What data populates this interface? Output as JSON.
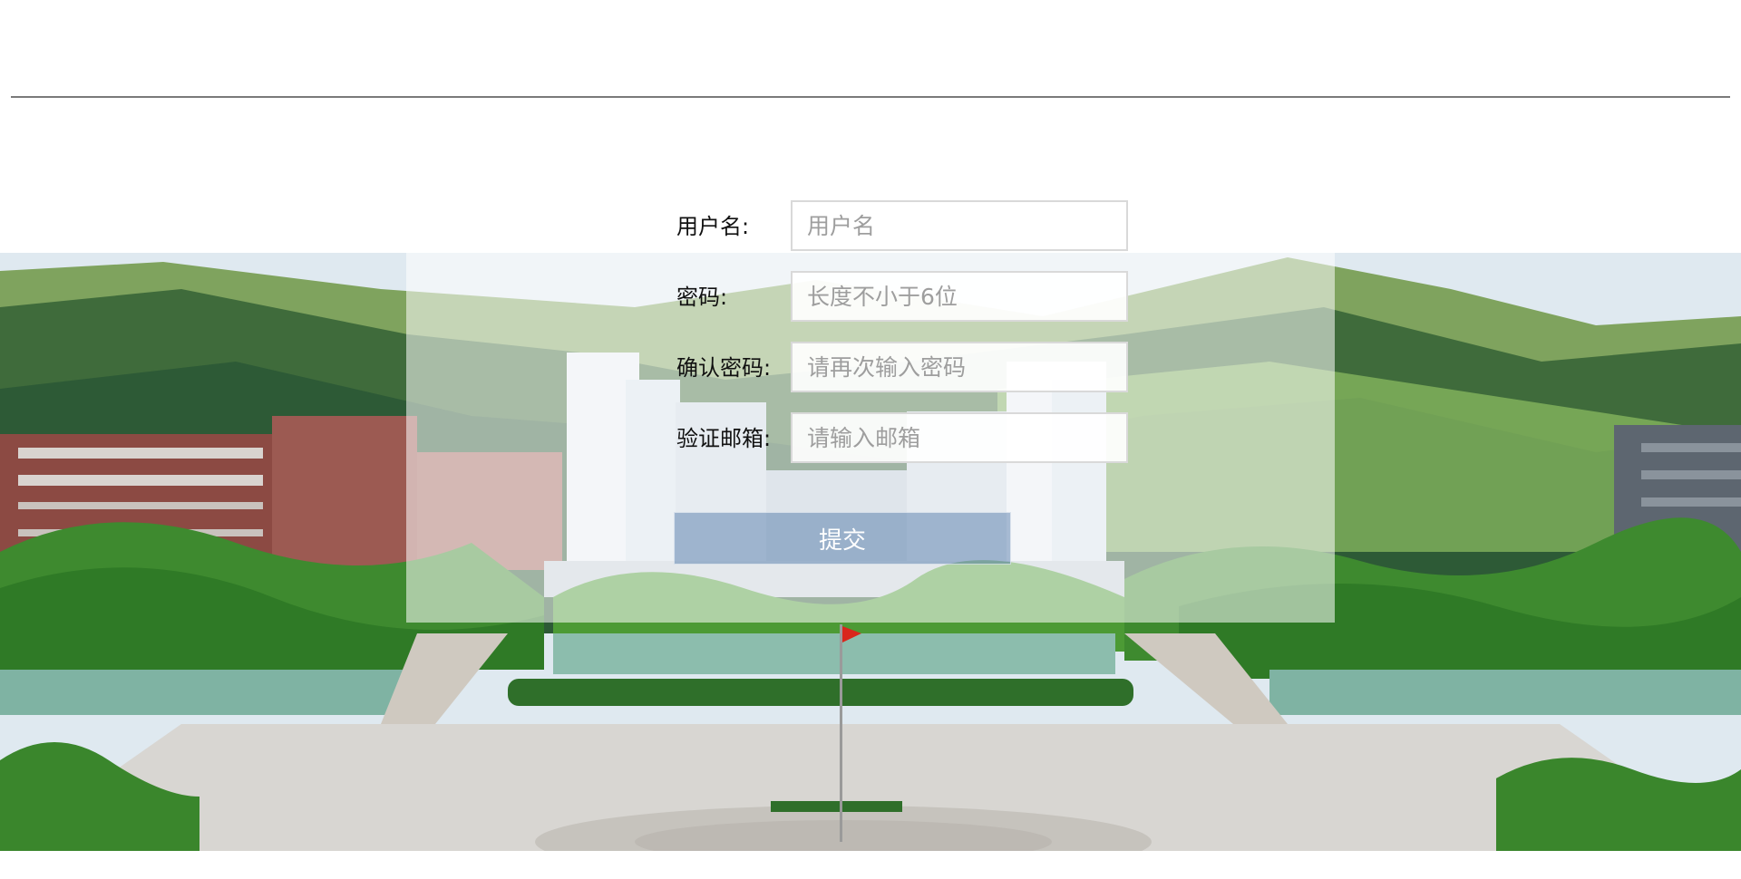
{
  "form": {
    "username_label": "用户名:",
    "username_placeholder": "用户名",
    "password_label": "密码:",
    "password_placeholder": "长度不小于6位",
    "confirm_label": "确认密码:",
    "confirm_placeholder": "请再次输入密码",
    "email_label": "验证邮箱:",
    "email_placeholder": "请输入邮箱",
    "submit_label": "提交"
  },
  "colors": {
    "page_background": "#ffffff",
    "divider": "#7a7a7a",
    "submit_background": "rgba(40,90,150,0.38)"
  }
}
